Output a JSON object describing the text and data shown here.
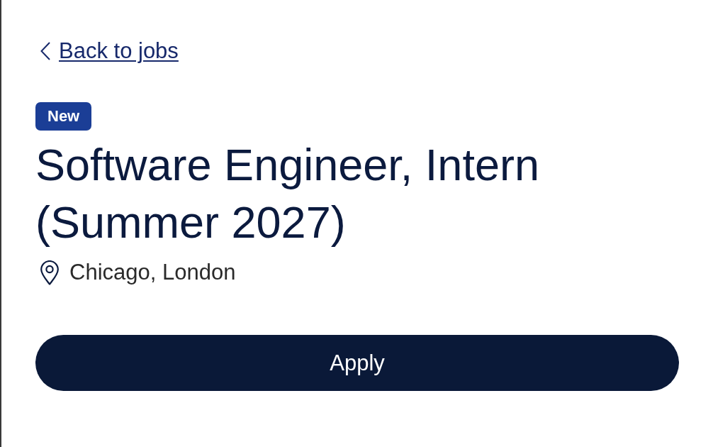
{
  "back_link": {
    "label": "Back to jobs"
  },
  "badge": {
    "label": "New"
  },
  "job": {
    "title": "Software Engineer, Intern (Summer 2027)",
    "location": "Chicago, London"
  },
  "apply_button": {
    "label": "Apply"
  }
}
